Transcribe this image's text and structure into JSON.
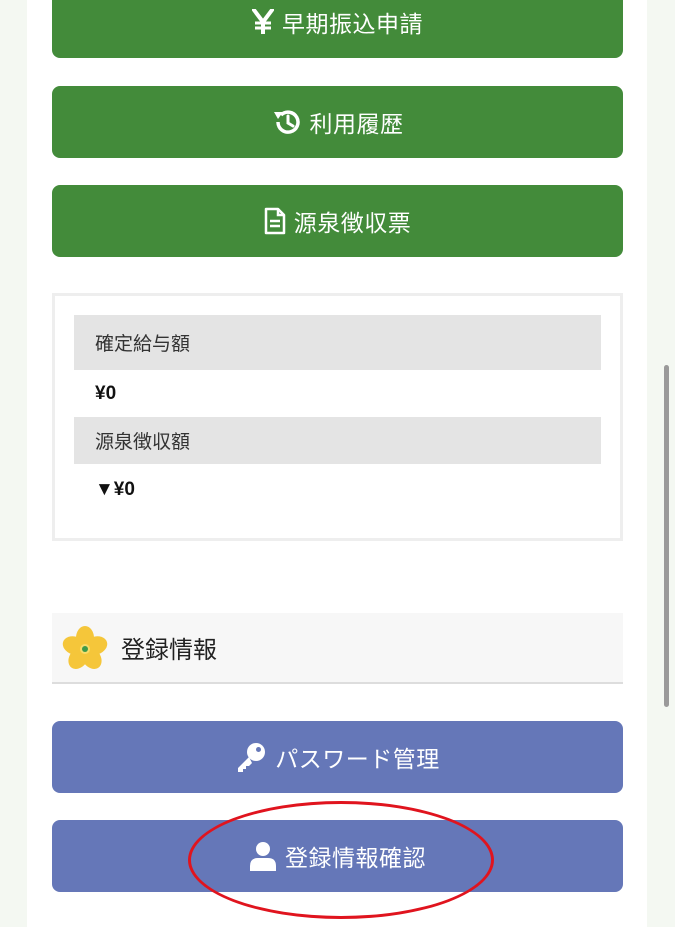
{
  "buttons": {
    "early_transfer": {
      "label": "早期振込申請",
      "icon": "yen-icon"
    },
    "usage_history": {
      "label": "利用履歴",
      "icon": "history-icon"
    },
    "withholding_slip": {
      "label": "源泉徴収票",
      "icon": "document-icon"
    },
    "password": {
      "label": "パスワード管理",
      "icon": "key-icon"
    },
    "registration_confirm": {
      "label": "登録情報確認",
      "icon": "user-icon"
    }
  },
  "summary": {
    "confirmed_salary_label": "確定給与額",
    "confirmed_salary_value": "¥0",
    "withholding_label": "源泉徴収額",
    "withholding_value": "▼¥0"
  },
  "registration_section": {
    "title": "登録情報",
    "icon": "flower-icon"
  },
  "colors": {
    "green_button": "#438b3a",
    "blue_button": "#6577b8",
    "annotation_circle": "#e0141e"
  }
}
